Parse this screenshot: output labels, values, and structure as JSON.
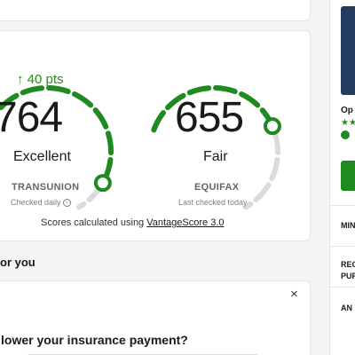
{
  "scores": [
    {
      "bureau": "TRANSUNION",
      "score": "764",
      "rating": "Excellent",
      "checked": "Checked daily",
      "change": "↑ 40 pts",
      "info_icon": "info-icon",
      "gauge_fraction": 0.86
    },
    {
      "bureau": "EQUIFAX",
      "score": "655",
      "rating": "Fair",
      "checked": "Last checked today",
      "gauge_fraction": 0.62
    }
  ],
  "footnote": {
    "prefix": "Scores calculated using ",
    "link": "VantageScore 3.0"
  },
  "section": {
    "title": "or you"
  },
  "promo": {
    "close_label": "×",
    "title": "lower your insurance payment?"
  },
  "sidebar": {
    "title_fragment": "Op",
    "items": [
      "MIN",
      "REC",
      "PUR",
      "AN"
    ]
  },
  "colors": {
    "gauge_active": "#1f8a1f",
    "gauge_track": "#d9dcdf",
    "knob_border": "#1f8a1f",
    "sidebar_button": "#1f8a1f",
    "sidebar_banner": "#243a5e"
  }
}
